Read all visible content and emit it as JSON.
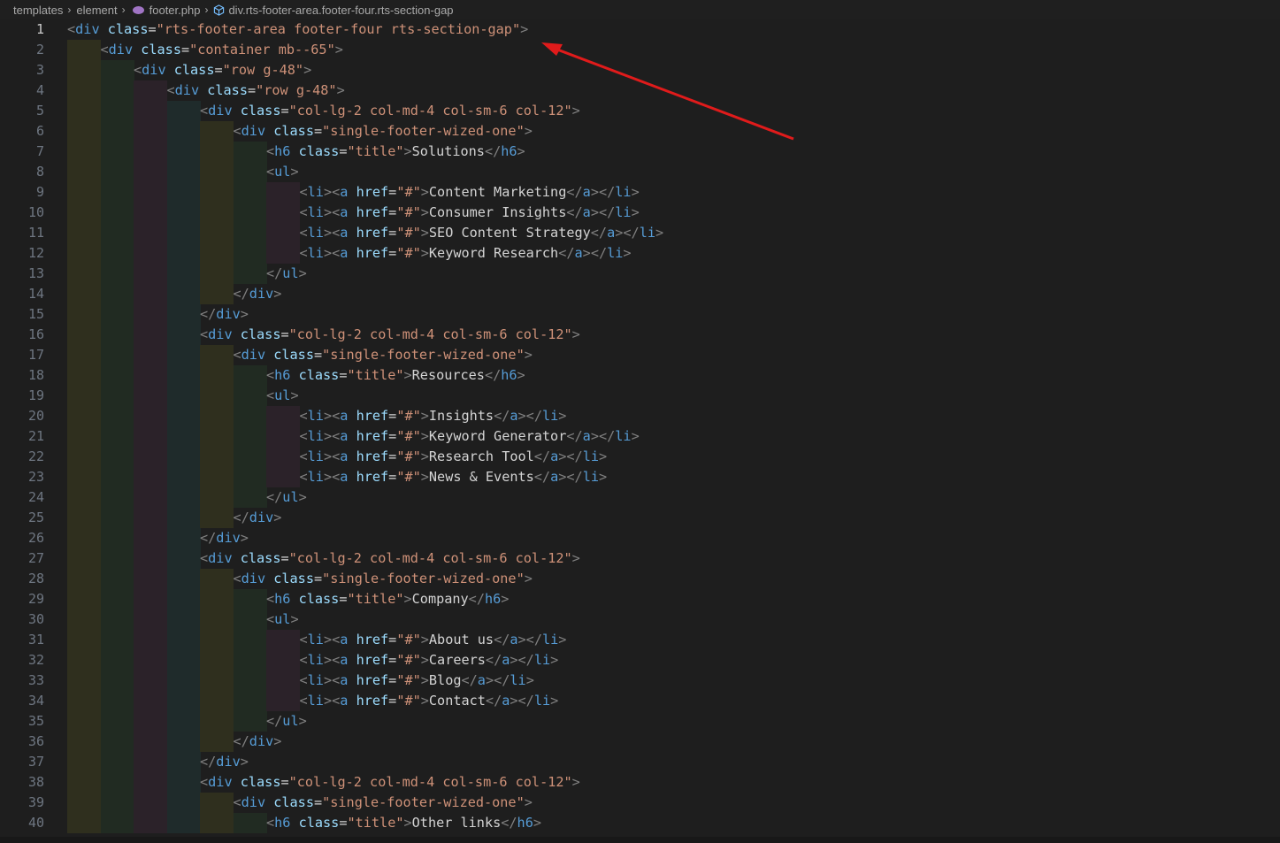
{
  "breadcrumb": {
    "items": [
      "templates",
      "element",
      "footer.php",
      "div.rts-footer-area.footer-four.rts-section-gap"
    ],
    "separator": "›"
  },
  "editor": {
    "active_line": 1,
    "lines": [
      {
        "n": "1",
        "indent": 0,
        "code": "<div class=\"rts-footer-area footer-four rts-section-gap\">"
      },
      {
        "n": "2",
        "indent": 1,
        "code": "<div class=\"container mb--65\">"
      },
      {
        "n": "3",
        "indent": 2,
        "code": "<div class=\"row g-48\">"
      },
      {
        "n": "4",
        "indent": 3,
        "code": "<div class=\"row g-48\">"
      },
      {
        "n": "5",
        "indent": 4,
        "code": "<div class=\"col-lg-2 col-md-4 col-sm-6 col-12\">"
      },
      {
        "n": "6",
        "indent": 5,
        "code": "<div class=\"single-footer-wized-one\">"
      },
      {
        "n": "7",
        "indent": 6,
        "code": "<h6 class=\"title\">Solutions</h6>"
      },
      {
        "n": "8",
        "indent": 6,
        "code": "<ul>"
      },
      {
        "n": "9",
        "indent": 7,
        "code": "<li><a href=\"#\">Content Marketing</a></li>"
      },
      {
        "n": "10",
        "indent": 7,
        "code": "<li><a href=\"#\">Consumer Insights</a></li>"
      },
      {
        "n": "11",
        "indent": 7,
        "code": "<li><a href=\"#\">SEO Content Strategy</a></li>"
      },
      {
        "n": "12",
        "indent": 7,
        "code": "<li><a href=\"#\">Keyword Research</a></li>"
      },
      {
        "n": "13",
        "indent": 6,
        "code": "</ul>"
      },
      {
        "n": "14",
        "indent": 5,
        "code": "</div>"
      },
      {
        "n": "15",
        "indent": 4,
        "code": "</div>"
      },
      {
        "n": "16",
        "indent": 4,
        "code": "<div class=\"col-lg-2 col-md-4 col-sm-6 col-12\">"
      },
      {
        "n": "17",
        "indent": 5,
        "code": "<div class=\"single-footer-wized-one\">"
      },
      {
        "n": "18",
        "indent": 6,
        "code": "<h6 class=\"title\">Resources</h6>"
      },
      {
        "n": "19",
        "indent": 6,
        "code": "<ul>"
      },
      {
        "n": "20",
        "indent": 7,
        "code": "<li><a href=\"#\">Insights</a></li>"
      },
      {
        "n": "21",
        "indent": 7,
        "code": "<li><a href=\"#\">Keyword Generator</a></li>"
      },
      {
        "n": "22",
        "indent": 7,
        "code": "<li><a href=\"#\">Research Tool</a></li>"
      },
      {
        "n": "23",
        "indent": 7,
        "code": "<li><a href=\"#\">News & Events</a></li>"
      },
      {
        "n": "24",
        "indent": 6,
        "code": "</ul>"
      },
      {
        "n": "25",
        "indent": 5,
        "code": "</div>"
      },
      {
        "n": "26",
        "indent": 4,
        "code": "</div>"
      },
      {
        "n": "27",
        "indent": 4,
        "code": "<div class=\"col-lg-2 col-md-4 col-sm-6 col-12\">"
      },
      {
        "n": "28",
        "indent": 5,
        "code": "<div class=\"single-footer-wized-one\">"
      },
      {
        "n": "29",
        "indent": 6,
        "code": "<h6 class=\"title\">Company</h6>"
      },
      {
        "n": "30",
        "indent": 6,
        "code": "<ul>"
      },
      {
        "n": "31",
        "indent": 7,
        "code": "<li><a href=\"#\">About us</a></li>"
      },
      {
        "n": "32",
        "indent": 7,
        "code": "<li><a href=\"#\">Careers</a></li>"
      },
      {
        "n": "33",
        "indent": 7,
        "code": "<li><a href=\"#\">Blog</a></li>"
      },
      {
        "n": "34",
        "indent": 7,
        "code": "<li><a href=\"#\">Contact</a></li>"
      },
      {
        "n": "35",
        "indent": 6,
        "code": "</ul>"
      },
      {
        "n": "36",
        "indent": 5,
        "code": "</div>"
      },
      {
        "n": "37",
        "indent": 4,
        "code": "</div>"
      },
      {
        "n": "38",
        "indent": 4,
        "code": "<div class=\"col-lg-2 col-md-4 col-sm-6 col-12\">"
      },
      {
        "n": "39",
        "indent": 5,
        "code": "<div class=\"single-footer-wized-one\">"
      },
      {
        "n": "40",
        "indent": 6,
        "code": "<h6 class=\"title\">Other links</h6>"
      }
    ]
  },
  "theme": {
    "background": "#1e1e1e",
    "indent_rainbow": [
      "#2f2f1e",
      "#212b22",
      "#2b2229",
      "#1f2b2b"
    ],
    "annotation_arrow": "#e01b1b"
  },
  "icons": {
    "file": "php-elephant-icon",
    "symbol": "html-element-symbol-icon"
  }
}
